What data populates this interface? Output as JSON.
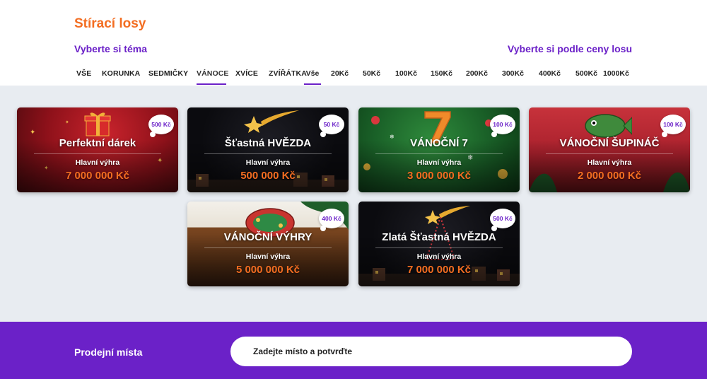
{
  "header": {
    "title": "Stírací losy",
    "theme_heading": "Vyberte si téma",
    "price_heading": "Vyberte si podle ceny losu"
  },
  "theme_tabs": [
    "VŠE",
    "KORUNKA",
    "SEDMIČKY",
    "VÁNOCE",
    "XVÍCE",
    "ZVÍŘÁTKA"
  ],
  "active_theme": "VÁNOCE",
  "price_tabs": [
    "Vše",
    "20Kč",
    "50Kč",
    "100Kč",
    "150Kč",
    "200Kč",
    "300Kč",
    "400Kč",
    "500Kč",
    "1000Kč"
  ],
  "active_price": "Vše",
  "cards": [
    {
      "title": "Perfektní dárek",
      "prize_label": "Hlavní výhra",
      "prize": "7 000 000 Kč",
      "price": "500 Kč"
    },
    {
      "title": "Šťastná HVĚZDA",
      "prize_label": "Hlavní výhra",
      "prize": "500 000 Kč",
      "price": "50 Kč"
    },
    {
      "title": "VÁNOČNÍ 7",
      "prize_label": "Hlavní výhra",
      "prize": "3 000 000 Kč",
      "price": "100 Kč"
    },
    {
      "title": "VÁNOČNÍ ŠUPINÁČ",
      "prize_label": "Hlavní výhra",
      "prize": "2 000 000 Kč",
      "price": "100 Kč"
    },
    {
      "title": "VÁNOČNÍ VÝHRY",
      "prize_label": "Hlavní výhra",
      "prize": "5 000 000 Kč",
      "price": "400 Kč"
    },
    {
      "title": "Zlatá Šťastná HVĚZDA",
      "prize_label": "Hlavní výhra",
      "prize": "7 000 000 Kč",
      "price": "500 Kč"
    }
  ],
  "footer": {
    "label": "Prodejní místa",
    "search_placeholder": "Zadejte místo a potvrďte"
  },
  "colors": {
    "brand_purple": "#6b21c8",
    "accent_orange": "#f36d21",
    "grid_background": "#e8ecf1"
  }
}
